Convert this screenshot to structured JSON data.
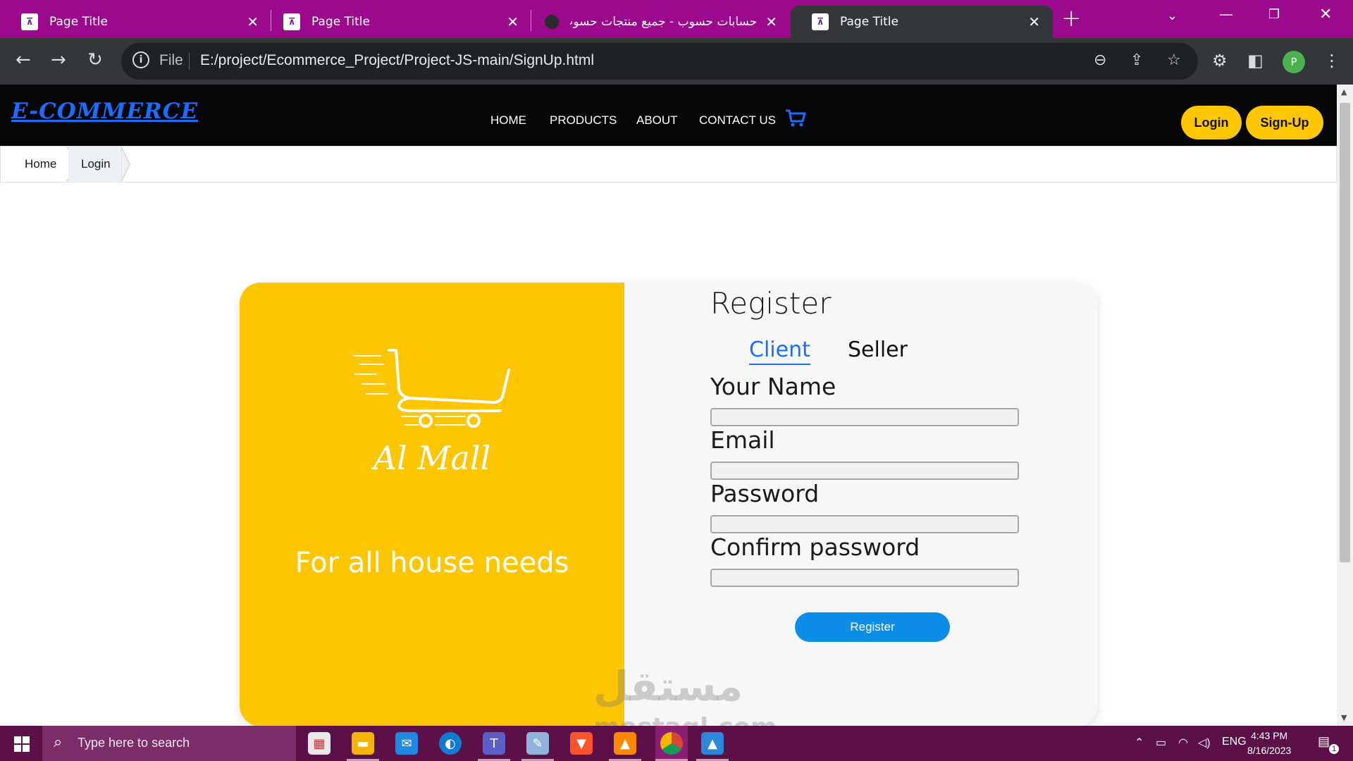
{
  "browser": {
    "tabs": [
      {
        "title": "Page Title",
        "favicon": "page-favicon",
        "active": false
      },
      {
        "title": "Page Title",
        "favicon": "page-favicon",
        "active": false
      },
      {
        "title": "حسابات حسوب - جميع منتجات حسوب",
        "favicon": "hsoub-favicon",
        "active": false
      },
      {
        "title": "Page Title",
        "favicon": "page-favicon",
        "active": true
      }
    ],
    "tab_close": "✕",
    "new_tab": "+",
    "address": {
      "scheme_label": "File",
      "url": "E:/project/Ecommerce_Project/Project-JS-main/SignUp.html"
    },
    "profile_initial": "P",
    "tab_bar_color": "#9b0a8c"
  },
  "site": {
    "logo": "E-COMMERCE",
    "nav": [
      "HOME",
      "PRODUCTS",
      "ABOUT",
      "CONTACT US"
    ],
    "login_label": "Login",
    "signup_label": "Sign-Up",
    "accent": "#ffc700",
    "link_color": "#1a6dff"
  },
  "breadcrumb": {
    "items": [
      "Home",
      "Login"
    ]
  },
  "card": {
    "brand": "Al Mall",
    "tagline": "For all house needs",
    "left_color": "#fec600",
    "title": "Register",
    "tabs": [
      "Client",
      "Seller"
    ],
    "active_tab": "Client",
    "fields": [
      {
        "label": "Your Name",
        "value": ""
      },
      {
        "label": "Email",
        "value": ""
      },
      {
        "label": "Password",
        "value": ""
      },
      {
        "label": "Confirm password",
        "value": ""
      }
    ],
    "submit_label": "Register",
    "submit_color": "#0c8ee8"
  },
  "watermark": {
    "text": "مستقل",
    "sub": "mostaql.com"
  },
  "taskbar": {
    "search_placeholder": "Type here to search",
    "apps": [
      "store",
      "file-explorer",
      "mail",
      "edge",
      "teams",
      "notepad",
      "brave",
      "vlc",
      "chrome",
      "photos"
    ],
    "language": "ENG",
    "time": "4:43 PM",
    "date": "8/16/2023",
    "notifications": "1"
  }
}
